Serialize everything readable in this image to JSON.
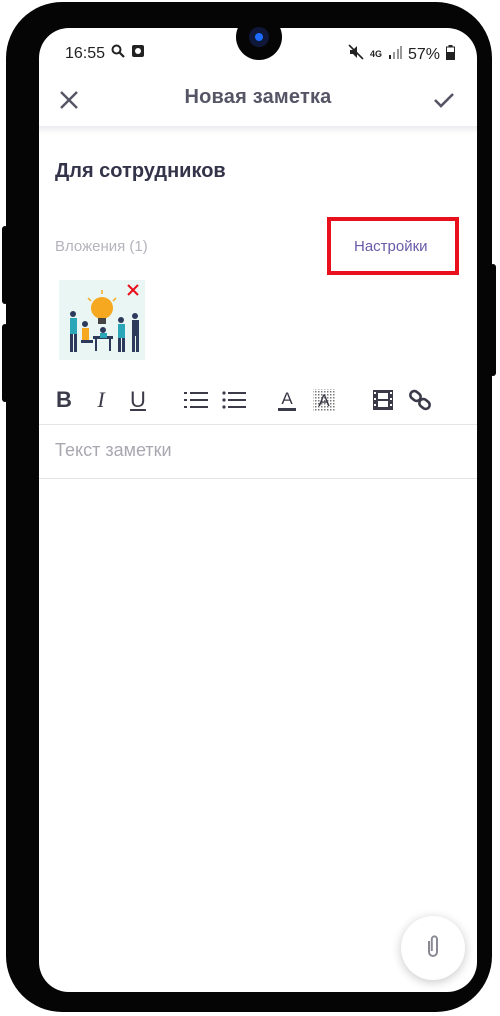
{
  "status_bar": {
    "time": "16:55",
    "network": "4G",
    "battery": "57%",
    "icons": [
      "search-icon",
      "screenshot-icon",
      "mute-icon",
      "signal-icon",
      "battery-icon"
    ]
  },
  "app_bar": {
    "title": "Новая заметка",
    "close_icon": "close-icon",
    "save_icon": "check-icon"
  },
  "note": {
    "title": "Для сотрудников",
    "attachments_label": "Вложения (1)",
    "settings_label": "Настройки",
    "body_placeholder": "Текст заметки"
  },
  "attachments": [
    {
      "type": "image",
      "description": "team-illustration",
      "remove_icon": "remove-icon"
    }
  ],
  "format_toolbar": {
    "bold": "B",
    "italic": "I",
    "underline": "U",
    "tools": [
      "bold-icon",
      "italic-icon",
      "underline-icon",
      "numbered-list-icon",
      "bullet-list-icon",
      "text-color-icon",
      "highlight-color-icon",
      "video-icon",
      "link-icon"
    ]
  },
  "fab": {
    "icon": "paperclip-icon"
  },
  "colors": {
    "accent": "#6a5aa8",
    "highlight_box": "#e8101c",
    "title_text": "#33334a",
    "muted_text": "#b4b4bc"
  }
}
